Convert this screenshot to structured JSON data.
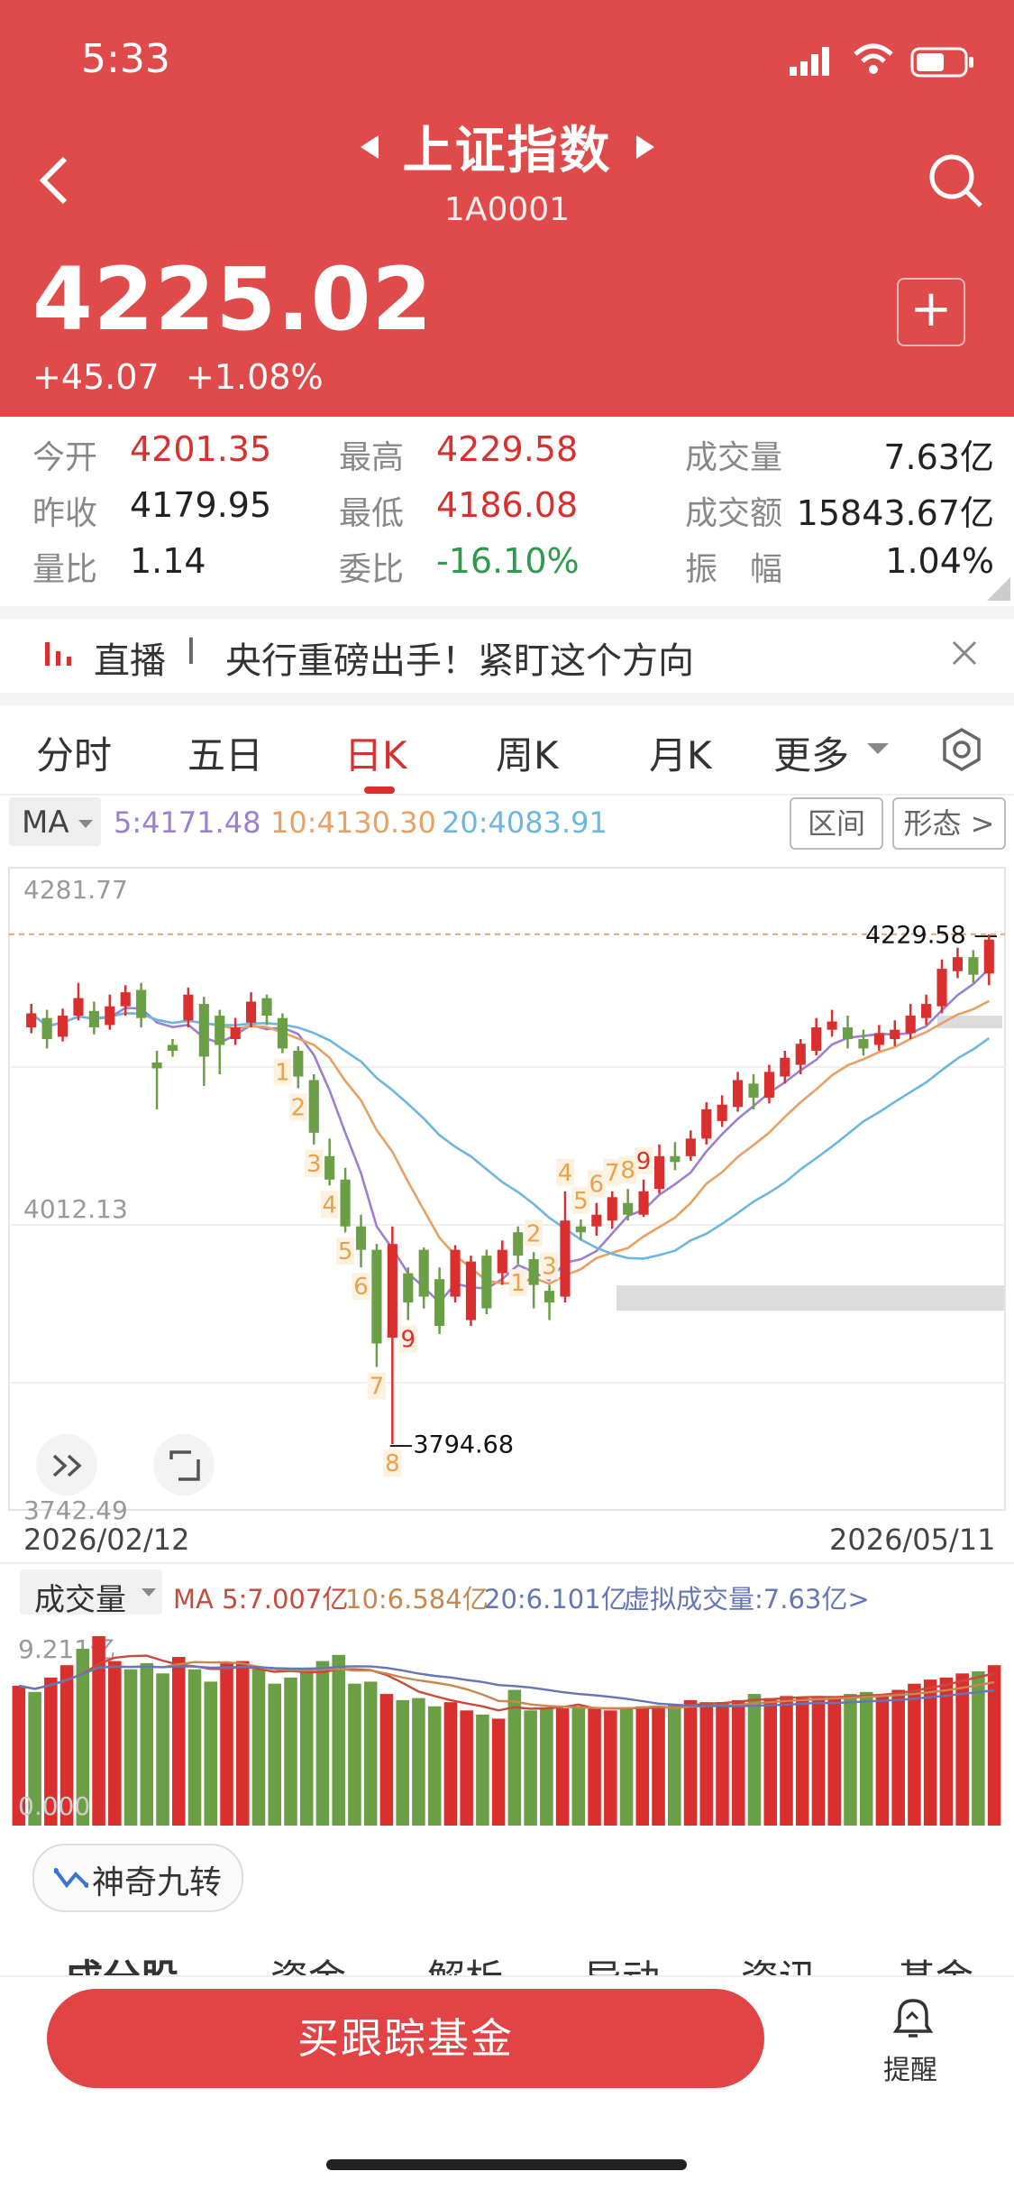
{
  "status": {
    "time": "5:33"
  },
  "header": {
    "title": "上证指数",
    "code": "1A0001",
    "price": "4225.02",
    "change": "+45.07",
    "change_pct": "+1.08%",
    "add_label": "+"
  },
  "stats": {
    "rows": [
      [
        {
          "label": "今开",
          "value": "4201.35",
          "tone": "red"
        },
        {
          "label": "最高",
          "value": "4229.58",
          "tone": "red"
        },
        {
          "label": "成交量",
          "value": "7.63亿",
          "tone": "plain"
        }
      ],
      [
        {
          "label": "昨收",
          "value": "4179.95",
          "tone": "plain"
        },
        {
          "label": "最低",
          "value": "4186.08",
          "tone": "red"
        },
        {
          "label": "成交额",
          "value": "15843.67亿",
          "tone": "plain"
        }
      ],
      [
        {
          "label": "量比",
          "value": "1.14",
          "tone": "plain"
        },
        {
          "label": "委比",
          "value": "-16.10%",
          "tone": "green"
        },
        {
          "label": "振　幅",
          "value": "1.04%",
          "tone": "plain"
        }
      ]
    ]
  },
  "live": {
    "tag": "直播",
    "sep": "I",
    "text": "央行重磅出手！紧盯这个方向"
  },
  "tabs": [
    "分时",
    "五日",
    "日K",
    "周K",
    "月K",
    "更多"
  ],
  "active_tab": 2,
  "ma": {
    "label": "MA",
    "ma5": "5:4171.48",
    "ma10": "10:4130.30",
    "ma20": "20:4083.91",
    "btn_range": "区间",
    "btn_pattern": "形态 >"
  },
  "colors": {
    "up": "#d9302f",
    "down": "#6b9f45",
    "ma5": "#9b7fd4",
    "ma10": "#e9a064",
    "ma20": "#6cb6e0",
    "header": "#df4b4a"
  },
  "chart_data": {
    "type": "candlestick",
    "ylim": [
      3742.49,
      4281.77
    ],
    "ytick_top": "4281.77",
    "ytick_mid": "4012.13",
    "ytick_bottom": "3742.49",
    "high_label": "4229.58",
    "low_label": "3794.68",
    "date_start": "2026/02/12",
    "date_end": "2026/05/11",
    "nine_turn_labels": [
      {
        "text": "1",
        "index": 16,
        "side": "low"
      },
      {
        "text": "2",
        "index": 17,
        "side": "low"
      },
      {
        "text": "3",
        "index": 18,
        "side": "low"
      },
      {
        "text": "4",
        "index": 19,
        "side": "low"
      },
      {
        "text": "5",
        "index": 20,
        "side": "low"
      },
      {
        "text": "6",
        "index": 21,
        "side": "low"
      },
      {
        "text": "7",
        "index": 22,
        "side": "low"
      },
      {
        "text": "8",
        "index": 23,
        "side": "low"
      },
      {
        "text": "9",
        "index": 24,
        "side": "low"
      },
      {
        "text": "1",
        "index": 31,
        "side": "low"
      },
      {
        "text": "2",
        "index": 32,
        "side": "high"
      },
      {
        "text": "3",
        "index": 33,
        "side": "high"
      },
      {
        "text": "4",
        "index": 34,
        "side": "high"
      },
      {
        "text": "5",
        "index": 35,
        "side": "high"
      },
      {
        "text": "6",
        "index": 36,
        "side": "high"
      },
      {
        "text": "7",
        "index": 37,
        "side": "high"
      },
      {
        "text": "8",
        "index": 38,
        "side": "high"
      },
      {
        "text": "9",
        "index": 39,
        "side": "high"
      }
    ],
    "candles": [
      [
        4150,
        4162,
        4170,
        4145
      ],
      [
        4158,
        4140,
        4165,
        4132
      ],
      [
        4142,
        4160,
        4166,
        4138
      ],
      [
        4160,
        4175,
        4188,
        4156
      ],
      [
        4164,
        4150,
        4172,
        4144
      ],
      [
        4152,
        4168,
        4178,
        4148
      ],
      [
        4168,
        4180,
        4186,
        4160
      ],
      [
        4182,
        4158,
        4188,
        4150
      ],
      [
        4120,
        4115,
        4130,
        4080
      ],
      [
        4135,
        4130,
        4140,
        4125
      ],
      [
        4156,
        4178,
        4184,
        4150
      ],
      [
        4170,
        4125,
        4176,
        4100
      ],
      [
        4160,
        4135,
        4165,
        4110
      ],
      [
        4140,
        4150,
        4158,
        4135
      ],
      [
        4154,
        4172,
        4180,
        4150
      ],
      [
        4175,
        4160,
        4178,
        4152
      ],
      [
        4158,
        4132,
        4162,
        4128
      ],
      [
        4130,
        4108,
        4134,
        4098
      ],
      [
        4105,
        4060,
        4110,
        4050
      ],
      [
        4040,
        4020,
        4055,
        4015
      ],
      [
        4020,
        3980,
        4030,
        3975
      ],
      [
        3980,
        3960,
        3990,
        3945
      ],
      [
        3960,
        3880,
        3965,
        3860
      ],
      [
        3885,
        3965,
        3980,
        3794
      ],
      [
        3940,
        3915,
        3945,
        3900
      ],
      [
        3960,
        3920,
        3962,
        3910
      ],
      [
        3935,
        3895,
        3945,
        3888
      ],
      [
        3920,
        3960,
        3964,
        3915
      ],
      [
        3900,
        3950,
        3955,
        3895
      ],
      [
        3955,
        3910,
        3960,
        3905
      ],
      [
        3940,
        3960,
        3968,
        3930
      ],
      [
        3975,
        3955,
        3980,
        3948
      ],
      [
        3952,
        3930,
        3958,
        3910
      ],
      [
        3925,
        3915,
        3930,
        3900
      ],
      [
        3920,
        3985,
        4010,
        3915
      ],
      [
        3980,
        3975,
        3986,
        3968
      ],
      [
        3980,
        3990,
        4000,
        3972
      ],
      [
        3985,
        4005,
        4010,
        3978
      ],
      [
        4000,
        3990,
        4012,
        3985
      ],
      [
        3990,
        4010,
        4020,
        3988
      ],
      [
        4012,
        4040,
        4050,
        4008
      ],
      [
        4040,
        4035,
        4052,
        4028
      ],
      [
        4040,
        4055,
        4062,
        4036
      ],
      [
        4055,
        4080,
        4086,
        4050
      ],
      [
        4070,
        4084,
        4092,
        4065
      ],
      [
        4082,
        4105,
        4112,
        4078
      ],
      [
        4102,
        4090,
        4110,
        4080
      ],
      [
        4090,
        4112,
        4118,
        4085
      ],
      [
        4108,
        4124,
        4130,
        4102
      ],
      [
        4118,
        4136,
        4140,
        4110
      ],
      [
        4130,
        4150,
        4158,
        4126
      ],
      [
        4148,
        4155,
        4165,
        4142
      ],
      [
        4150,
        4140,
        4160,
        4132
      ],
      [
        4140,
        4132,
        4148,
        4126
      ],
      [
        4135,
        4145,
        4152,
        4130
      ],
      [
        4140,
        4148,
        4156,
        4134
      ],
      [
        4145,
        4160,
        4170,
        4140
      ],
      [
        4158,
        4170,
        4178,
        4152
      ],
      [
        4168,
        4200,
        4208,
        4162
      ],
      [
        4198,
        4210,
        4218,
        4192
      ],
      [
        4210,
        4195,
        4216,
        4188
      ],
      [
        4196,
        4225,
        4229.58,
        4186
      ]
    ]
  },
  "volume": {
    "label": "成交量",
    "ma5": "MA 5:7.007亿",
    "ma10": "10:6.584亿",
    "ma20": "20:6.101亿",
    "virtual": "虚拟成交量:7.63亿>",
    "ytop": "9.211亿",
    "ybottom": "0.000",
    "max": 9.211,
    "values": [
      6.8,
      6.5,
      7.2,
      7.8,
      8.6,
      9.21,
      8.0,
      7.6,
      7.9,
      7.4,
      8.2,
      7.6,
      7.0,
      7.9,
      8.0,
      7.6,
      6.9,
      7.2,
      7.6,
      8.0,
      8.3,
      6.9,
      7.0,
      6.4,
      6.1,
      6.2,
      5.8,
      6.0,
      5.6,
      5.4,
      5.2,
      6.6,
      5.6,
      5.7,
      5.7,
      5.8,
      5.7,
      5.6,
      5.7,
      5.8,
      5.8,
      5.9,
      6.1,
      6.0,
      6.0,
      6.1,
      6.4,
      6.2,
      6.3,
      6.2,
      6.2,
      6.3,
      6.4,
      6.5,
      6.4,
      6.6,
      6.9,
      7.1,
      7.2,
      7.4,
      7.5,
      7.8
    ]
  },
  "nine_turn": {
    "label": "神奇九转"
  },
  "bottom_tabs": [
    "成分股",
    "资金",
    "解析",
    "异动",
    "资讯",
    "基金"
  ],
  "footer": {
    "button": "买跟踪基金",
    "remind": "提醒"
  }
}
